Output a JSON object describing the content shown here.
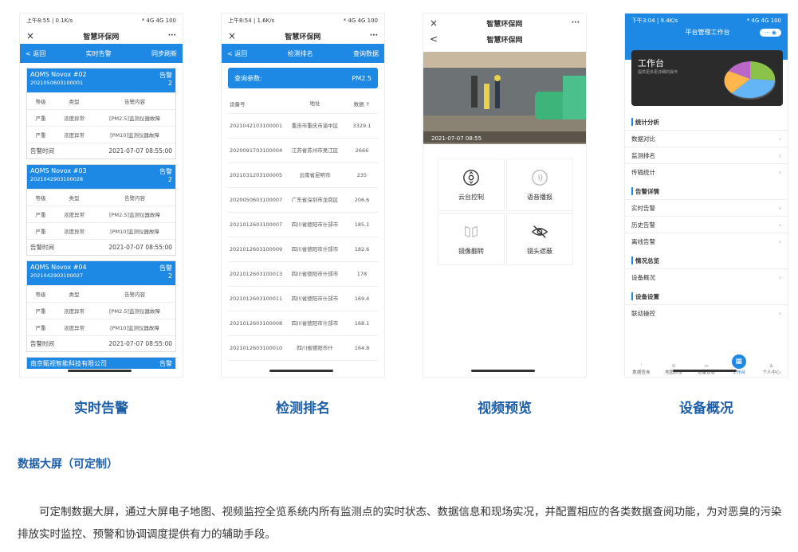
{
  "phones": [
    {
      "status_left": "上午8:55 | 0.1K/s",
      "status_right": "* 4G 4G 100",
      "title": "智慧环保网",
      "close": "×",
      "more": "···",
      "header": {
        "back": "< 返回",
        "title": "实时告警",
        "action": "同步刷新"
      },
      "cards": [
        {
          "name": "AQMS Novox #02",
          "id": "2021050603100001",
          "badge": "告警",
          "count": "2",
          "cols": [
            "等级",
            "类型",
            "告警内容"
          ],
          "rows": [
            [
              "严重",
              "浓度异常",
              "[PM2.5]监测仪器故障"
            ],
            [
              "严重",
              "浓度异常",
              "[PM10]监测仪器故障"
            ]
          ],
          "time_label": "告警时间",
          "time": "2021-07-07 08:55:00"
        },
        {
          "name": "AQMS Novox #03",
          "id": "2021042903100028",
          "badge": "告警",
          "count": "2",
          "cols": [
            "等级",
            "类型",
            "告警内容"
          ],
          "rows": [
            [
              "严重",
              "浓度异常",
              "[PM2.5]监测仪器故障"
            ],
            [
              "严重",
              "浓度异常",
              "[PM10]监测仪器故障"
            ]
          ],
          "time_label": "告警时间",
          "time": "2021-07-07 08:55:00"
        },
        {
          "name": "AQMS Novox #04",
          "id": "2021042903100027",
          "badge": "告警",
          "count": "2",
          "cols": [
            "等级",
            "类型",
            "告警内容"
          ],
          "rows": [
            [
              "严重",
              "浓度异常",
              "[PM2.5]监测仪器故障"
            ],
            [
              "严重",
              "浓度异常",
              "[PM10]监测仪器故障"
            ]
          ],
          "time_label": "告警时间",
          "time": "2021-07-07 08:55:00"
        }
      ],
      "last_card": {
        "name": "南京甄视智能科技有限公司",
        "badge": "告警"
      },
      "caption": "实时告警"
    },
    {
      "status_left": "上午8:54 | 1.6K/s",
      "status_right": "* 4G 4G 100",
      "title": "智慧环保网",
      "close": "×",
      "more": "···",
      "header": {
        "back": "< 返回",
        "title": "检测排名",
        "action": "查询数据"
      },
      "param_label": "查询参数:",
      "param_value": "PM2.5",
      "cols": [
        "设备号",
        "地址",
        "数据 ↑"
      ],
      "rows": [
        [
          "2021042103100001",
          "重庆市重庆市渝中区",
          "3329.1"
        ],
        [
          "2020091703100004",
          "江苏省苏州市吴江区",
          "2666"
        ],
        [
          "2021031203100005",
          "云南省昆明市",
          "235"
        ],
        [
          "2020050603100007",
          "广东省深圳市龙岗区",
          "206.6"
        ],
        [
          "2021012603100007",
          "四川省德阳市什邡市",
          "185.1"
        ],
        [
          "2021012603100009",
          "四川省德阳市什邡市",
          "182.6"
        ],
        [
          "2021012603100013",
          "四川省德阳市什邡市",
          "178"
        ],
        [
          "2021012603100011",
          "四川省德阳市什邡市",
          "169.4"
        ],
        [
          "2021012603100008",
          "四川省德阳市什邡市",
          "168.1"
        ],
        [
          "2021012603100010",
          "四川省德阳市什",
          "164.8"
        ]
      ],
      "caption": "检测排名"
    },
    {
      "title": "智慧环保网",
      "close": "×",
      "more": "···",
      "subtitle": "智慧环保网",
      "back": "<",
      "video_stamp": "2021-07-07 08:55",
      "controls": [
        "云台控制",
        "语音播报",
        "镜像翻转",
        "镜头遮蔽"
      ],
      "caption": "视频预览"
    },
    {
      "status_left": "下午3:04 | 9.4K/s",
      "status_right": "* 4G 4G 100",
      "header_title": "平台管理工作台",
      "capsule": "···",
      "work_title": "工作台",
      "work_sub": "提供更多更详细的操作",
      "sections": [
        {
          "title": "统计分析",
          "items": [
            "数据对比",
            "监测排名",
            "传输统计"
          ]
        },
        {
          "title": "告警详情",
          "items": [
            "实时告警",
            "历史告警",
            "离线告警"
          ]
        },
        {
          "title": "情况总览",
          "items": [
            "设备概况"
          ]
        },
        {
          "title": "设备设置",
          "items": [
            "联动操控"
          ]
        }
      ],
      "tabs": [
        "数据查询",
        "地图研览",
        "设备查看",
        "工作台",
        "个人中心"
      ],
      "caption": "设备概况"
    }
  ],
  "heading": "数据大屏（可定制）",
  "paragraph": "可定制数据大屏，通过大屏电子地图、视频监控全览系统内所有监测点的实时状态、数据信息和现场实况，并配置相应的各类数据查阅功能，为对恶臭的污染排放实时监控、预警和协调调度提供有力的辅助手段。",
  "colors": {
    "primary": "#1e88e5",
    "caption": "#1d5fa8"
  }
}
